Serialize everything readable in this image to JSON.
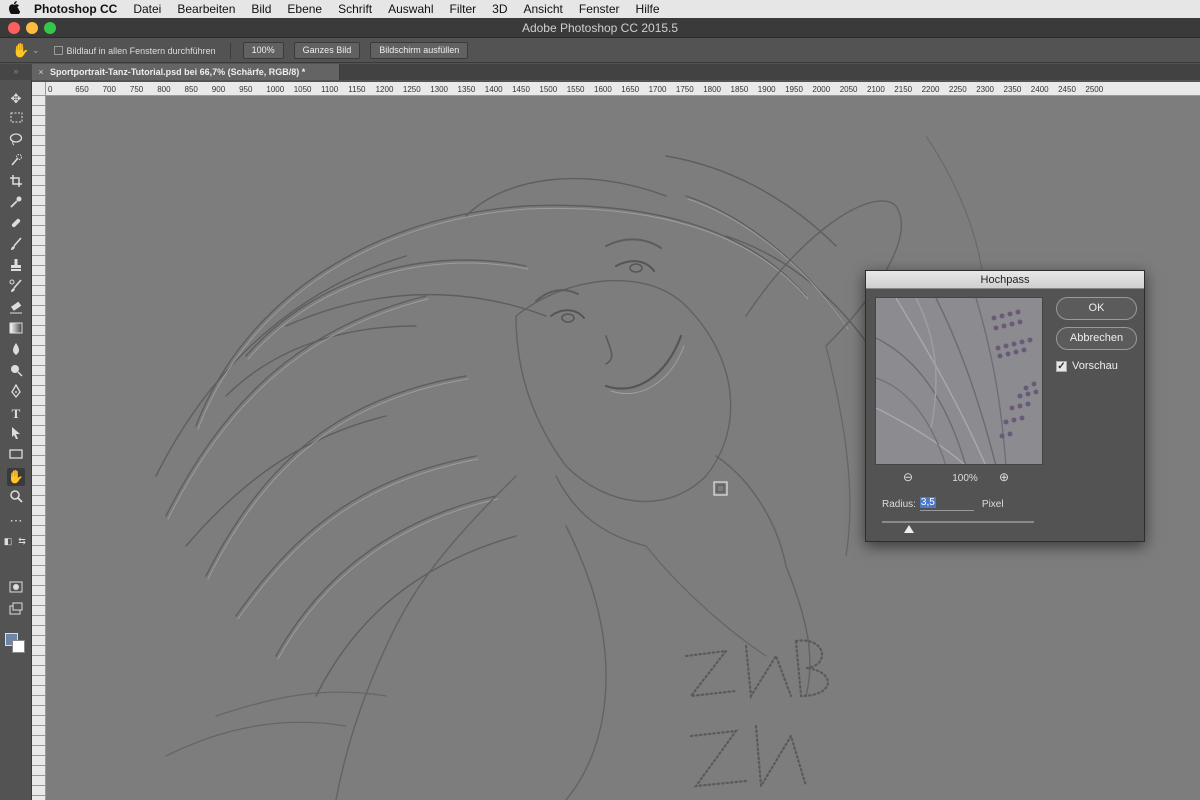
{
  "menubar": {
    "apple": "",
    "app_name": "Photoshop CC",
    "items": [
      "Datei",
      "Bearbeiten",
      "Bild",
      "Ebene",
      "Schrift",
      "Auswahl",
      "Filter",
      "3D",
      "Ansicht",
      "Fenster",
      "Hilfe"
    ]
  },
  "window": {
    "title": "Adobe Photoshop CC 2015.5"
  },
  "options": {
    "scroll_all_label": "Bildlauf in allen Fenstern durchführen",
    "zoom_100": "100%",
    "fit_screen": "Ganzes Bild",
    "fill_screen": "Bildschirm ausfüllen"
  },
  "document": {
    "tab_title": "Sportportrait-Tanz-Tutorial.psd bei 66,7% (Schärfe, RGB/8) *",
    "ruler_ticks": [
      "0",
      "650",
      "700",
      "750",
      "800",
      "850",
      "900",
      "950",
      "1000",
      "1050",
      "1100",
      "1150",
      "1200",
      "1250",
      "1300",
      "1350",
      "1400",
      "1450",
      "1500",
      "1550",
      "1600",
      "1650",
      "1700",
      "1750",
      "1800",
      "1850",
      "1900",
      "1950",
      "2000",
      "2050",
      "2100",
      "2150",
      "2200",
      "2250",
      "2300",
      "2350",
      "2400",
      "2450",
      "2500"
    ]
  },
  "dialog": {
    "title": "Hochpass",
    "ok": "OK",
    "cancel": "Abbrechen",
    "preview_label": "Vorschau",
    "preview_checked": true,
    "zoom": "100%",
    "radius_label": "Radius:",
    "radius_value": "3,5",
    "radius_unit": "Pixel",
    "slider_fraction": 0.18
  },
  "colors": {
    "foreground": "#6d86a7",
    "background": "#ffffff"
  }
}
